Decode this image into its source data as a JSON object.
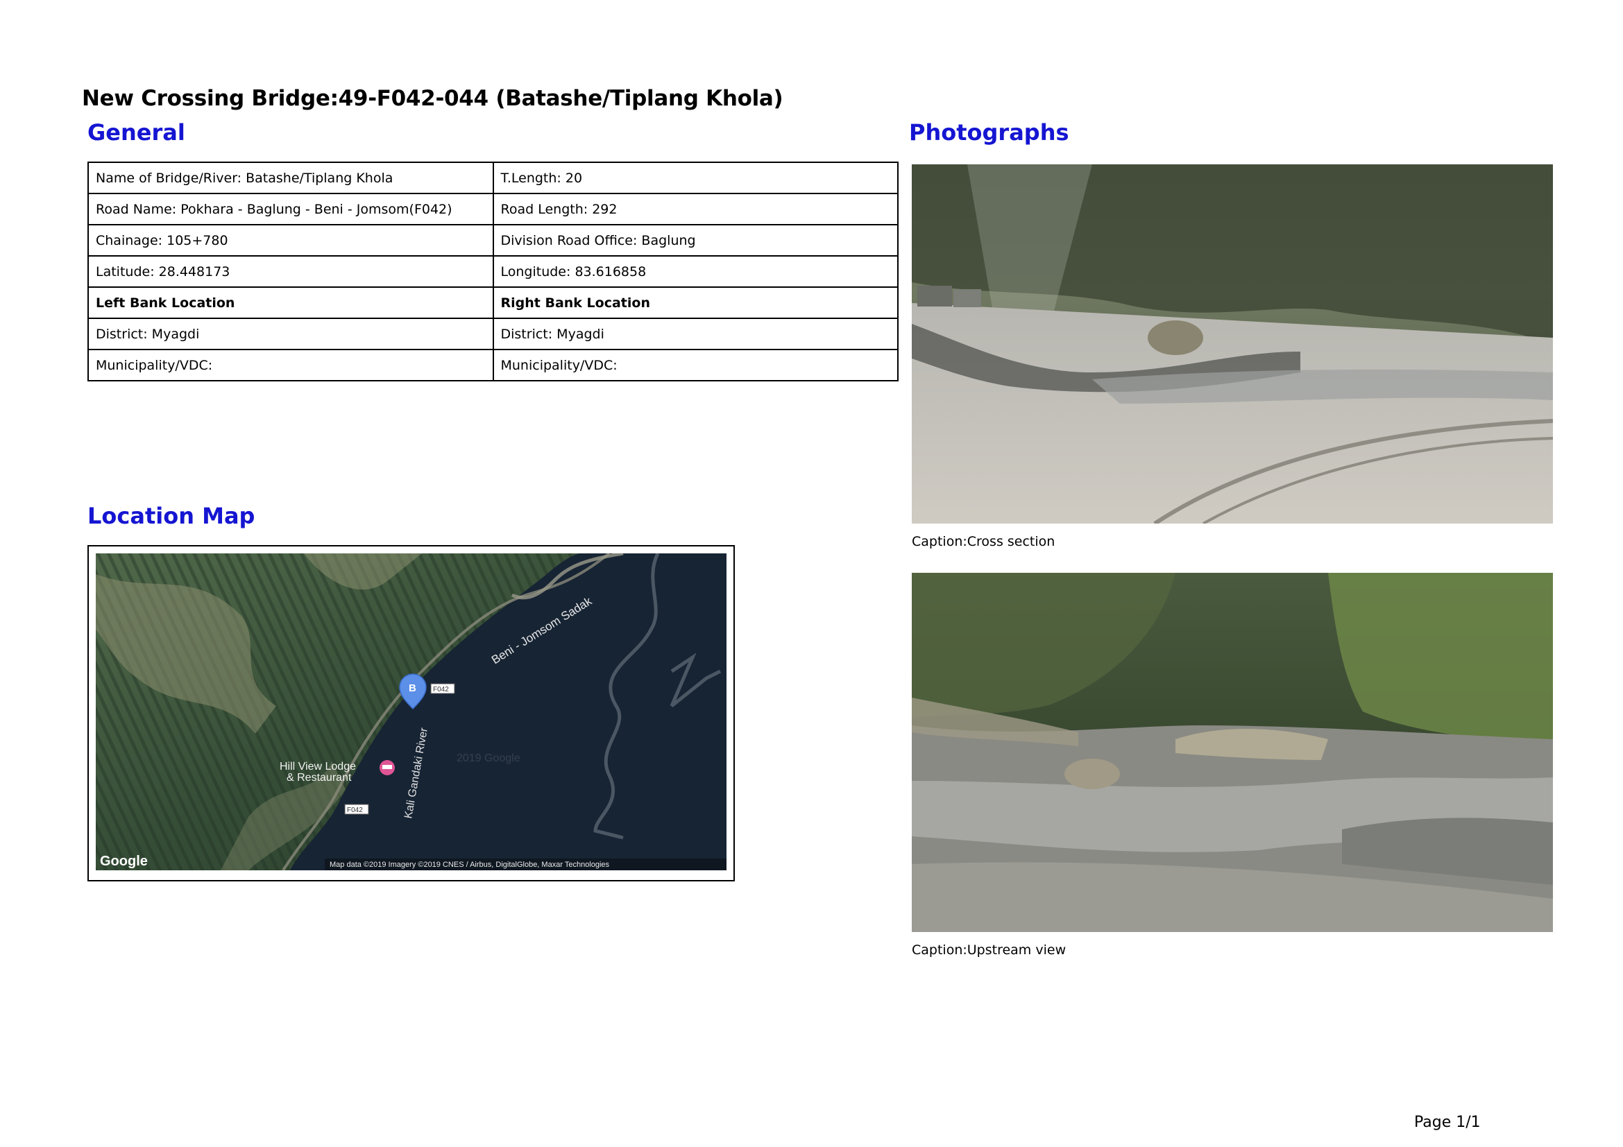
{
  "title": "New Crossing Bridge:49-F042-044 (Batashe/Tiplang Khola)",
  "sections": {
    "general": "General",
    "photographs": "Photographs",
    "location_map": "Location Map"
  },
  "general_table": [
    [
      "Name of Bridge/River: Batashe/Tiplang Khola",
      "T.Length: 20"
    ],
    [
      "Road Name: Pokhara - Baglung - Beni - Jomsom(F042)",
      "Road Length: 292"
    ],
    [
      "Chainage: 105+780",
      "Division Road Office: Baglung"
    ],
    [
      "Latitude: 28.448173",
      "Longitude: 83.616858"
    ],
    [
      "Left Bank Location",
      "Right Bank Location"
    ],
    [
      "District: Myagdi",
      "District: Myagdi"
    ],
    [
      "Municipality/VDC:",
      "Municipality/VDC:"
    ]
  ],
  "map": {
    "road_label": "Beni - Jomsom Sadak",
    "route_badge_1": "F042",
    "route_badge_2": "F042",
    "marker_letter": "B",
    "poi_line1": "Hill View Lodge",
    "poi_line2": "& Restaurant",
    "river_label": "Kali Gandaki River",
    "watermark": "2019 Google",
    "logo": "Google",
    "attribution": "Map data ©2019  Imagery ©2019 CNES / Airbus, DigitalGlobe, Maxar Technologies",
    "colors": {
      "water": "#172434",
      "terrain": "#3f5a3e",
      "marker": "#5b8fe8",
      "poi": "#e05595"
    }
  },
  "photos": [
    {
      "caption": "Caption:Cross section"
    },
    {
      "caption": "Caption:Upstream view"
    }
  ],
  "page_number": "Page 1/1",
  "colors": {
    "heading": "#1515d2"
  }
}
